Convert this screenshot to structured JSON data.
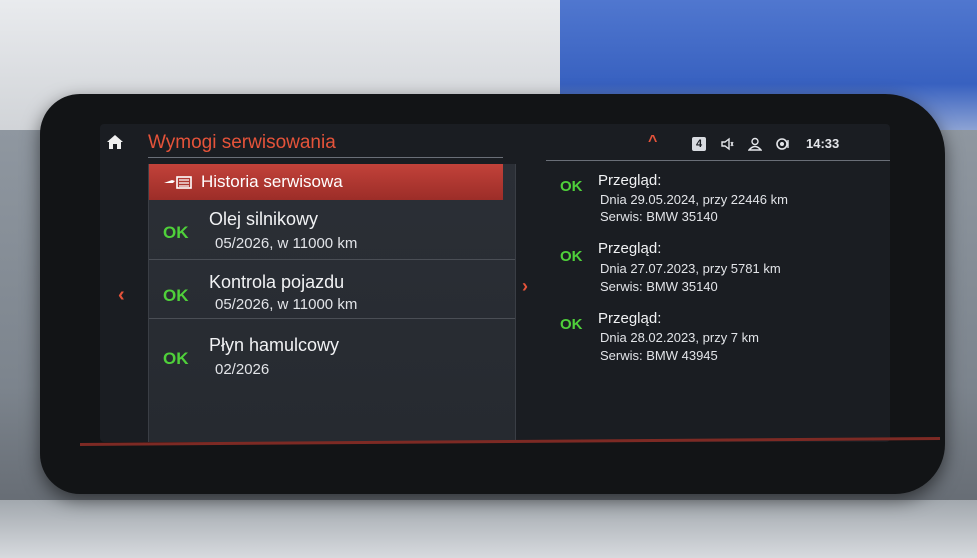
{
  "header": {
    "title": "Wymogi serwisowania",
    "status": {
      "badge": "4",
      "clock": "14:33",
      "icons": [
        "chevron-up-icon",
        "volume-icon",
        "user-icon",
        "connectivity-icon"
      ]
    }
  },
  "menu": {
    "history_label": "Historia serwisowa",
    "items": [
      {
        "status": "OK",
        "title": "Olej silnikowy",
        "detail": "05/2026, w 11000 km"
      },
      {
        "status": "OK",
        "title": "Kontrola pojazdu",
        "detail": "05/2026, w 11000 km"
      },
      {
        "status": "OK",
        "title": "Płyn hamulcowy",
        "detail": "02/2026"
      }
    ]
  },
  "history": [
    {
      "status": "OK",
      "title": "Przegląd:",
      "date_line": "Dnia 29.05.2024, przy 22446 km",
      "service_line": "Serwis: BMW 35140"
    },
    {
      "status": "OK",
      "title": "Przegląd:",
      "date_line": "Dnia 27.07.2023, przy 5781 km",
      "service_line": "Serwis: BMW 35140"
    },
    {
      "status": "OK",
      "title": "Przegląd:",
      "date_line": "Dnia 28.02.2023, przy 7 km",
      "service_line": "Serwis: BMW 43945"
    }
  ],
  "nav": {
    "left": "‹",
    "right": "›",
    "up": "^"
  },
  "colors": {
    "accent": "#e5533a",
    "ok": "#4fd03a",
    "highlight": "#b73a33",
    "screen": "#1a1d22"
  }
}
